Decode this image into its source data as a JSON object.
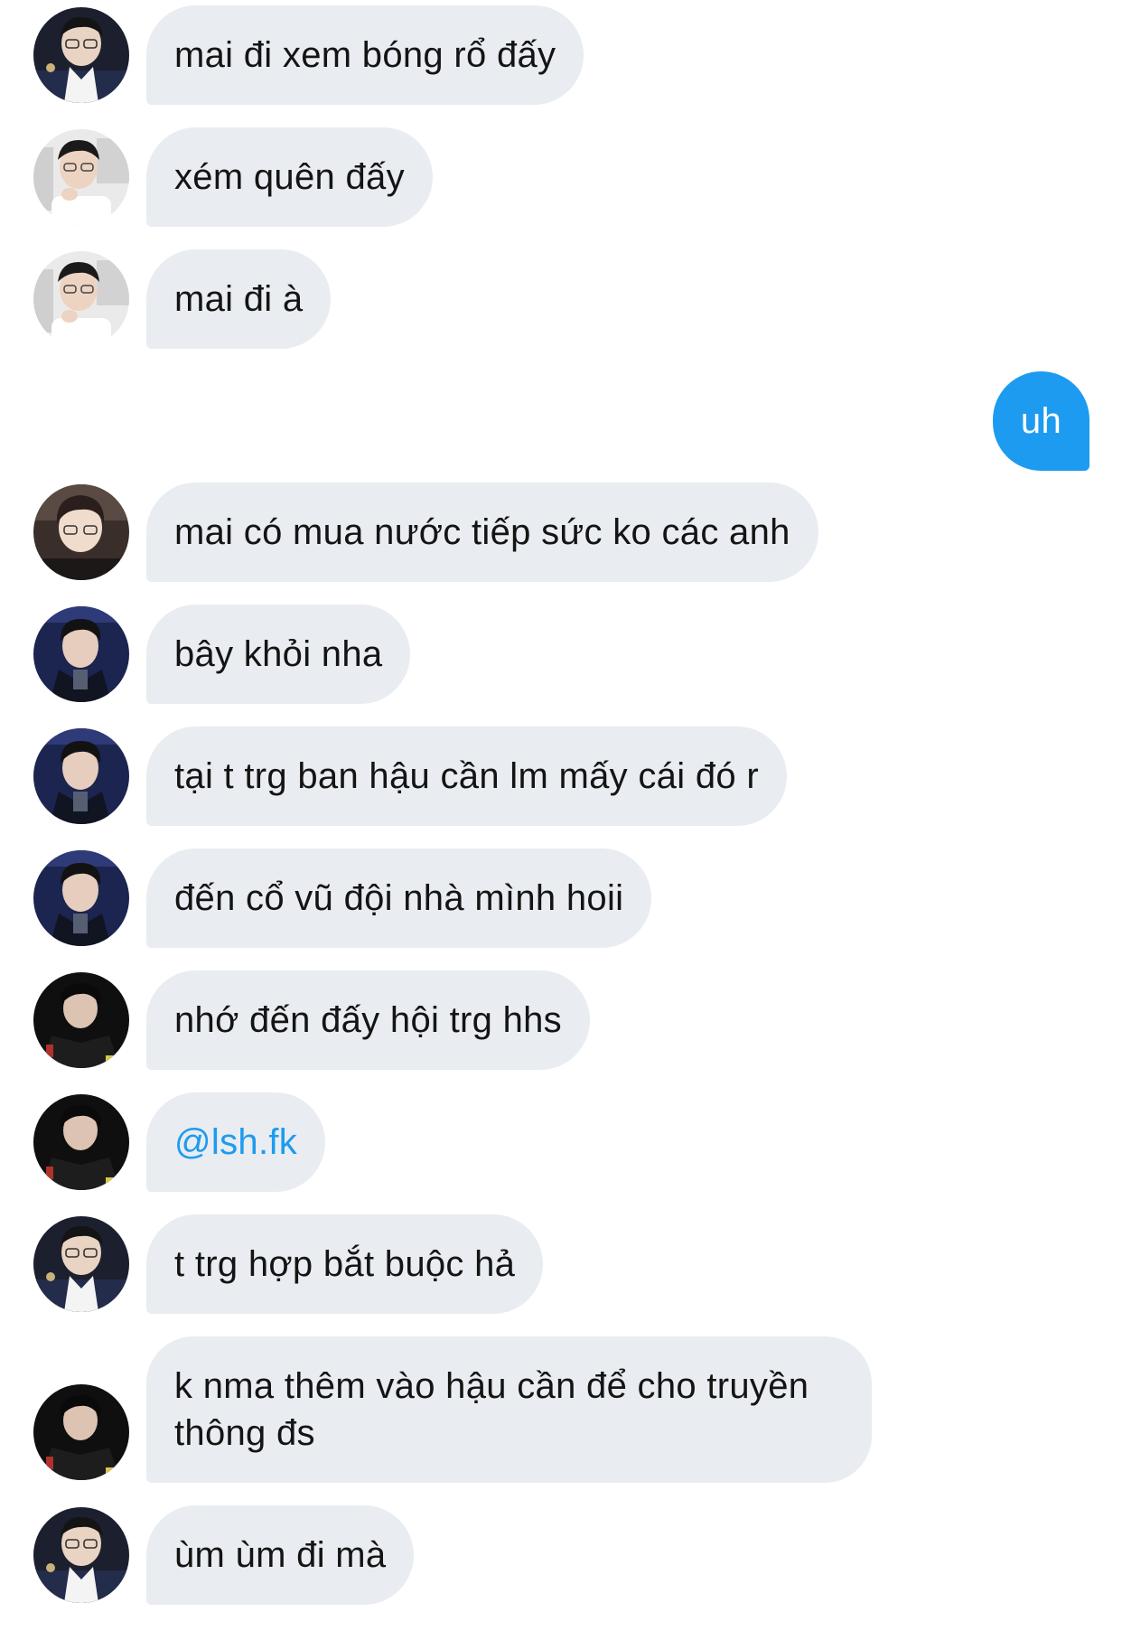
{
  "messages": [
    {
      "text": "mai đi xem bóng rổ đấy",
      "avatar": "avatar-a"
    },
    {
      "text": "xém quên đấy",
      "avatar": "avatar-b"
    },
    {
      "text": "mai đi à",
      "avatar": "avatar-b"
    },
    {
      "text": "uh",
      "mine": true
    },
    {
      "text": "mai có mua nước tiếp sức ko các anh",
      "avatar": "avatar-c"
    },
    {
      "text": "bây khỏi nha",
      "avatar": "avatar-d"
    },
    {
      "text": "tại t trg ban hậu cần lm mấy cái đó r",
      "avatar": "avatar-d"
    },
    {
      "text": "đến cổ vũ đội nhà mình hoii",
      "avatar": "avatar-d"
    },
    {
      "text": "nhớ đến đấy hội trg hhs",
      "avatar": "avatar-e"
    },
    {
      "text": "@lsh.fk",
      "avatar": "avatar-e",
      "link": true
    },
    {
      "text": "t trg hợp bắt buộc hả",
      "avatar": "avatar-a"
    },
    {
      "text": "k nma thêm vào hậu cần để cho truyền thông đs",
      "avatar": "avatar-e"
    },
    {
      "text": "ùm ùm đi mà",
      "avatar": "avatar-a"
    }
  ],
  "colors": {
    "incoming_bubble": "#e9ecf1",
    "outgoing_bubble": "#1d9bf0",
    "mention_text": "#1d9bf0",
    "text": "#141414"
  }
}
